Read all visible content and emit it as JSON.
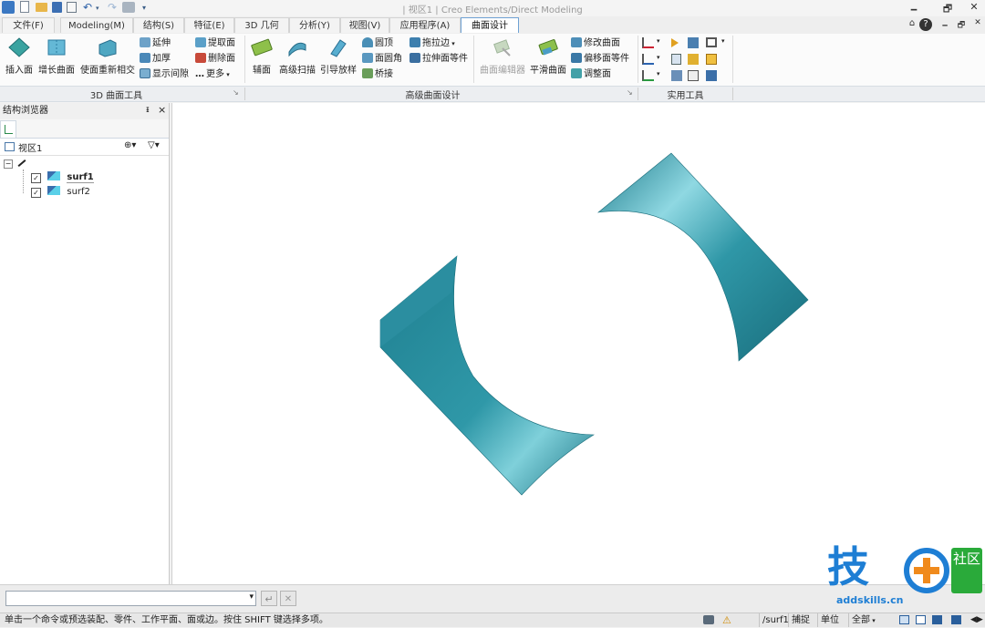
{
  "window": {
    "title": "| 视区1 |  Creo Elements/Direct Modeling",
    "controls": [
      "🗕",
      "🗗",
      "✕"
    ],
    "tab_controls": [
      "⌂",
      "?",
      "🗕",
      "🗗",
      "✕"
    ]
  },
  "quick_access": [
    "新建",
    "打开",
    "保存",
    "打印预览",
    "撤销",
    "重做",
    "选项"
  ],
  "tabs": [
    {
      "label": "文件(F)",
      "active": false
    },
    {
      "label": "Modeling(M)",
      "active": false
    },
    {
      "label": "结构(S)",
      "active": false
    },
    {
      "label": "特征(E)",
      "active": false
    },
    {
      "label": "3D 几何",
      "active": false
    },
    {
      "label": "分析(Y)",
      "active": false
    },
    {
      "label": "视图(V)",
      "active": false
    },
    {
      "label": "应用程序(A)",
      "active": false
    },
    {
      "label": "曲面设计",
      "active": true
    }
  ],
  "ribbon": {
    "group1": {
      "big": [
        "插入面",
        "增长曲面",
        "使面重新相交"
      ],
      "small_col1": [
        "延伸",
        "加厚",
        "显示间隙"
      ],
      "small_col2": [
        "提取面",
        "删除面",
        "更多"
      ],
      "label": "3D 曲面工具"
    },
    "group2": {
      "big": [
        "辅面",
        "高级扫描",
        "引导放样"
      ],
      "small_col1": [
        "圆顶",
        "面圆角",
        "桥接"
      ],
      "small_col2": [
        "拖拉边",
        "拉伸面等件"
      ],
      "label": "高级曲面设计"
    },
    "group3": {
      "big": [
        "曲面编辑器",
        "平滑曲面"
      ],
      "small_col1": [
        "修改曲面",
        "偏移面等件",
        "调整面"
      ]
    },
    "group4": {
      "label": "实用工具"
    }
  },
  "browser": {
    "title": "结构浏览器",
    "pin": "ᵻ",
    "close": "×",
    "view_label": "视区1",
    "items": [
      {
        "label": "surf1",
        "checked": true,
        "bold": true
      },
      {
        "label": "surf2",
        "checked": true,
        "bold": false
      }
    ]
  },
  "command": {
    "input_value": "",
    "enter": "↵",
    "cancel": "✕"
  },
  "status": {
    "message": "单击一个命令或预选装配、零件、工作平面、面或边。按住 SHIFT 键选择多项。",
    "part": "/surf1",
    "snap": "捕捉",
    "unit": "单位",
    "filter": "全部"
  },
  "watermark": {
    "brand": "技",
    "community": "社区",
    "url": "addskills.cn"
  },
  "colors": {
    "accent_tab": "#6fa2d4",
    "surface": "#2a8c9c",
    "watermark": "#1e7ed4",
    "watermark_orange": "#f08a1c"
  }
}
